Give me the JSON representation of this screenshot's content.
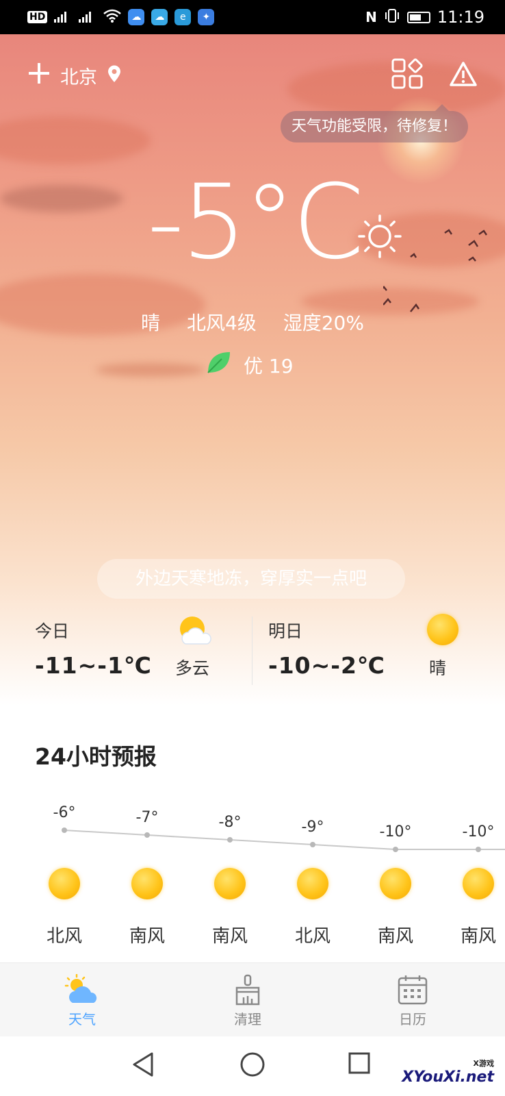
{
  "status_bar": {
    "left_chips": [
      "HD",
      "4G",
      "4G"
    ],
    "time": "11:19"
  },
  "header": {
    "city": "北京",
    "add_icon": "plus-icon",
    "location_icon": "location-pin-icon",
    "apps_icon": "widgets-icon",
    "alert_icon": "warning-icon",
    "tooltip": "天气功能受限，待修复！"
  },
  "current": {
    "temperature": "-5°C",
    "condition": "晴",
    "wind": "北风4级",
    "humidity": "湿度20%",
    "aqi": "优 19",
    "tip": "外边天寒地冻，穿厚实一点吧"
  },
  "days": [
    {
      "label": "今日",
      "range": "-11~-1℃",
      "condition": "多云",
      "icon": "partly-cloudy-icon"
    },
    {
      "label": "明日",
      "range": "-10~-2℃",
      "condition": "晴",
      "icon": "sun-icon"
    }
  ],
  "forecast": {
    "title": "24小时预报",
    "hours": [
      {
        "temp": "-6°",
        "value": -6,
        "wind": "北风"
      },
      {
        "temp": "-7°",
        "value": -7,
        "wind": "南风"
      },
      {
        "temp": "-8°",
        "value": -8,
        "wind": "南风"
      },
      {
        "temp": "-9°",
        "value": -9,
        "wind": "北风"
      },
      {
        "temp": "-10°",
        "value": -10,
        "wind": "南风"
      },
      {
        "temp": "-10°",
        "value": -10,
        "wind": "南风"
      }
    ]
  },
  "tabs": [
    {
      "label": "天气",
      "icon": "weather-icon",
      "active": true
    },
    {
      "label": "清理",
      "icon": "broom-icon",
      "active": false
    },
    {
      "label": "日历",
      "icon": "calendar-icon",
      "active": false
    }
  ],
  "watermark": {
    "text": "XYouXi.net",
    "sub": "X游戏"
  },
  "colors": {
    "accent": "#4da3ff",
    "sun": "#ffc41a"
  }
}
